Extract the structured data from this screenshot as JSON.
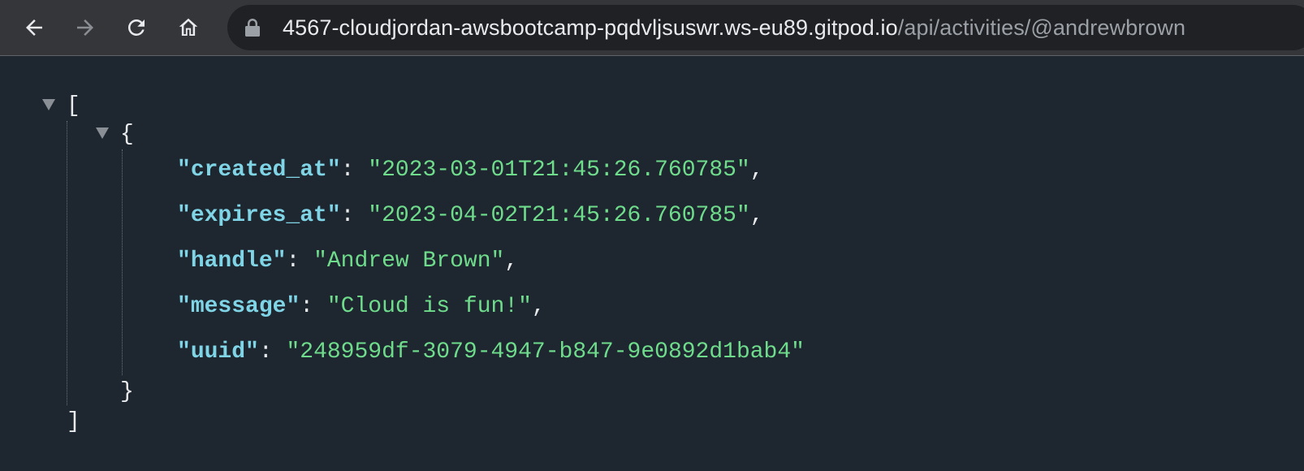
{
  "browser": {
    "url_host": "4567-cloudjordan-awsbootcamp-pqdvljsuswr.ws-eu89.gitpod.io",
    "url_path": "/api/activities/@andrewbrown",
    "buttons": [
      "back-icon",
      "forward-icon",
      "reload-icon",
      "home-icon",
      "lock-icon"
    ]
  },
  "json_viewer": {
    "array_open": "[",
    "array_close": "]",
    "object_open": "{",
    "object_close": "}",
    "quote": "\"",
    "colon": ": ",
    "comma": ",",
    "entries": [
      {
        "key": "created_at",
        "value": "2023-03-01T21:45:26.760785"
      },
      {
        "key": "expires_at",
        "value": "2023-04-02T21:45:26.760785"
      },
      {
        "key": "handle",
        "value": "Andrew Brown"
      },
      {
        "key": "message",
        "value": "Cloud is fun!"
      },
      {
        "key": "uuid",
        "value": "248959df-3079-4947-b847-9e0892d1bab4"
      }
    ]
  },
  "colors": {
    "toolbar": "#35363a",
    "omnibox": "#202124",
    "page_background": "#1e2730",
    "json_key": "#7fd4e6",
    "json_string": "#6fdc8c"
  }
}
